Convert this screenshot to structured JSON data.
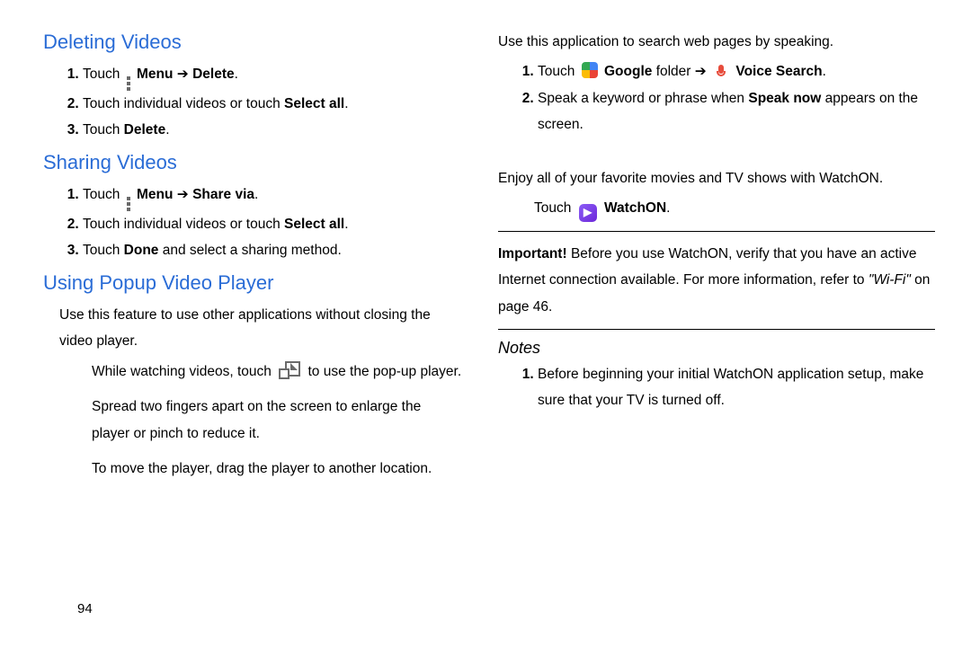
{
  "left": {
    "deleting": {
      "heading": "Deleting Videos",
      "step1_touch": "Touch",
      "step1_menu": "Menu",
      "step1_arrow": " ➔ ",
      "step1_delete": "Delete",
      "step2_a": "Touch individual videos or touch ",
      "step2_b": "Select all",
      "step3_a": "Touch ",
      "step3_b": "Delete"
    },
    "sharing": {
      "heading": "Sharing Videos",
      "step1_touch": "Touch",
      "step1_menu": "Menu",
      "step1_arrow": " ➔ ",
      "step1_share": "Share via",
      "step2_a": "Touch individual videos or touch ",
      "step2_b": "Select all",
      "step3_a": "Touch ",
      "step3_b": "Done",
      "step3_c": " and select a sharing method."
    },
    "popup": {
      "heading": "Using Popup Video Player",
      "intro": "Use this feature to use other applications without closing the video player.",
      "b1_a": "While watching videos, touch ",
      "b1_b": " to use the pop-up player.",
      "b2": "Spread two fingers apart on the screen to enlarge the player or pinch to reduce it.",
      "b3": "To move the player, drag the player to another location."
    }
  },
  "right": {
    "voice": {
      "intro": "Use this application to search web pages by speaking.",
      "step1_touch": "Touch ",
      "step1_google": "Google",
      "step1_folder": " folder ➔ ",
      "step1_voice": "Voice Search",
      "step2_a": "Speak a keyword or phrase when ",
      "step2_b": "Speak now",
      "step2_c": " appears on the screen."
    },
    "watchon": {
      "intro": "Enjoy all of your favorite movies and TV shows with WatchON.",
      "touch": "Touch ",
      "label": "WatchON",
      "important_label": "Important!",
      "important_a": " Before you use WatchON, verify that you have an active Internet connection available. For more information, refer to ",
      "important_wifi": "\"Wi-Fi\"",
      "important_b": " on page 46."
    },
    "notes": {
      "heading": "Notes",
      "n1": "Before beginning your initial WatchON application setup, make sure that your TV is turned off."
    }
  },
  "pagenum": "94"
}
